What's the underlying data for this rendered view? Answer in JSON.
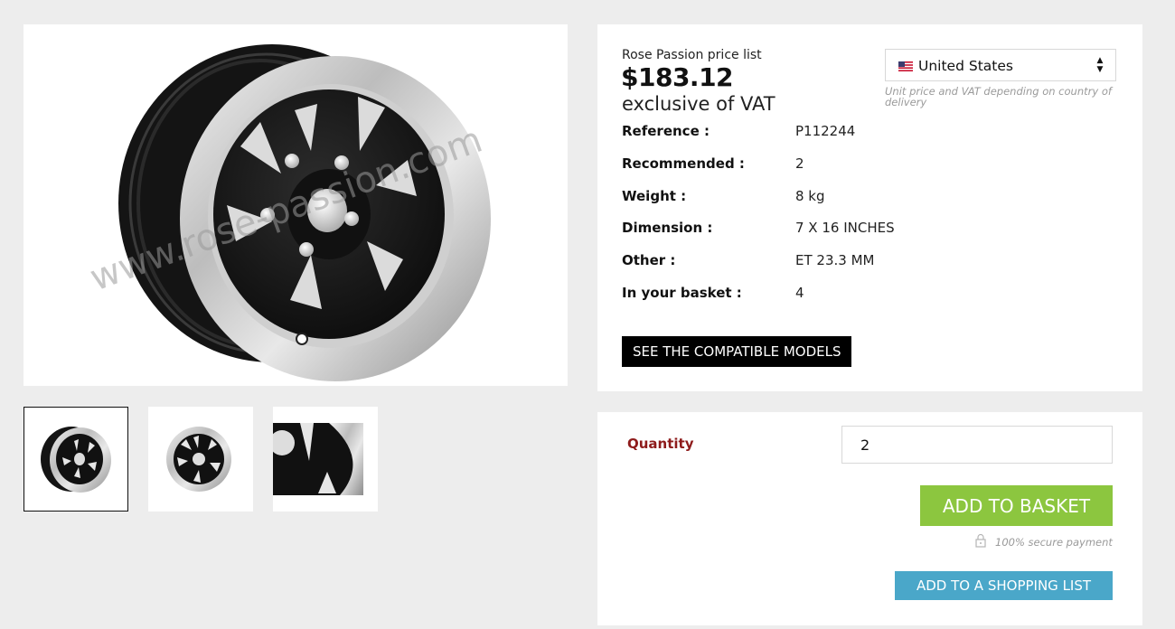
{
  "product": {
    "pricelist_label": "Rose Passion price list",
    "price": "$183.12",
    "vat_note": "exclusive of VAT"
  },
  "country": {
    "selected": "United States",
    "flag_icon": "us-flag-icon",
    "note": "Unit price and VAT depending on country of delivery"
  },
  "specs": [
    {
      "label": "Reference :",
      "value": "P112244"
    },
    {
      "label": "Recommended :",
      "value": "2"
    },
    {
      "label": "Weight :",
      "value": "8 kg"
    },
    {
      "label": "Dimension :",
      "value": "7 X 16 INCHES"
    },
    {
      "label": "Other :",
      "value": "ET 23.3 MM"
    },
    {
      "label": "In your basket :",
      "value": "4"
    }
  ],
  "buttons": {
    "compatible_models": "SEE THE COMPATIBLE MODELS",
    "add_to_basket": "ADD TO BASKET",
    "add_to_list": "ADD TO A SHOPPING LIST"
  },
  "quantity": {
    "label": "Quantity",
    "value": "2"
  },
  "secure_payment": "100% secure payment",
  "gallery": {
    "watermark": "www.rose-passion.com",
    "thumbnails": [
      "wheel-front-view",
      "wheel-flat-view",
      "wheel-detail-closeup"
    ],
    "active_thumbnail": 1
  },
  "colors": {
    "page_bg": "#ededed",
    "quantity_label": "#8e1b1b",
    "add_to_basket_bg": "#8cc63f",
    "add_to_list_bg": "#4aa7c9",
    "compat_button_bg": "#000000"
  }
}
